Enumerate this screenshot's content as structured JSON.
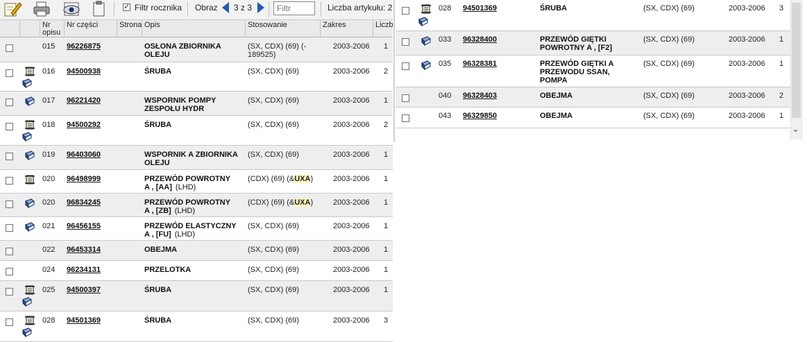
{
  "toolbar": {
    "filter_rocznika_label": "Filtr rocznika",
    "filter_rocznika_checked": true,
    "obraz_label": "Obraz",
    "page_indicator": "3 z 3",
    "filter_placeholder": "Filtr",
    "article_count_label": "Liczba artykułu: 2"
  },
  "columns": {
    "nr_opisu": "Nr opisu",
    "nr_czesci": "Nr części",
    "strona": "Strona",
    "opis": "Opis",
    "stosowanie": "Stosowanie",
    "zakres": "Zakres",
    "liczba": "Liczb"
  },
  "left_rows": [
    {
      "nr": "015",
      "part": "96226875",
      "desc": "OSŁONA ZBIORNIKA OLEJU",
      "desc_lines": [
        "OSŁONA ZBIORNIKA",
        "OLEJU"
      ],
      "side": "",
      "stos_lines": [
        "(SX, CDX) (69) (-",
        "189525)"
      ],
      "zakres": "2003-2006",
      "qty": "1",
      "icons": []
    },
    {
      "nr": "016",
      "part": "94500938",
      "desc_lines": [
        "ŚRUBA"
      ],
      "side": "",
      "stos_lines": [
        "(SX, CDX) (69)"
      ],
      "zakres": "2003-2006",
      "qty": "2",
      "icons": [
        "scroll",
        "book"
      ]
    },
    {
      "nr": "017",
      "part": "96221420",
      "desc_lines": [
        "WSPORNIK POMPY",
        "ZESPOŁU HYDR"
      ],
      "side": "",
      "stos_lines": [
        "(SX, CDX) (69)"
      ],
      "zakres": "2003-2006",
      "qty": "1",
      "icons": [
        "book"
      ]
    },
    {
      "nr": "018",
      "part": "94500292",
      "desc_lines": [
        "ŚRUBA"
      ],
      "side": "",
      "stos_lines": [
        "(SX, CDX) (69)"
      ],
      "zakres": "2003-2006",
      "qty": "2",
      "icons": [
        "scroll",
        "book"
      ]
    },
    {
      "nr": "019",
      "part": "96403060",
      "desc_lines": [
        "WSPORNIK A ZBIORNIKA",
        "OLEJU"
      ],
      "side": "",
      "stos_lines": [
        "(SX, CDX) (69)"
      ],
      "zakres": "2003-2006",
      "qty": "1",
      "icons": [
        "book"
      ]
    },
    {
      "nr": "020",
      "part": "96498999",
      "desc_lines": [
        "PRZEWÓD POWROTNY",
        "A , [AA]"
      ],
      "lhd": "(LHD)",
      "side": "",
      "stos_pre": "(CDX) (69) (&",
      "stos_hl": "UXA",
      "stos_post": ")",
      "zakres": "2003-2006",
      "qty": "1",
      "icons": [
        "scroll"
      ]
    },
    {
      "nr": "020",
      "part": "96834245",
      "desc_lines": [
        "PRZEWÓD POWROTNY",
        "A , [ZB]"
      ],
      "lhd": "(LHD)",
      "side": "",
      "stos_pre": "(CDX) (69) (&",
      "stos_hl": "UXA",
      "stos_post": ")",
      "zakres": "2003-2006",
      "qty": "1",
      "icons": [
        "book"
      ]
    },
    {
      "nr": "021",
      "part": "96456155",
      "desc_lines": [
        "PRZEWÓD ELASTYCZNY",
        "A , [FU]"
      ],
      "lhd": "(LHD)",
      "side": "",
      "stos_lines": [
        "(SX, CDX) (69)"
      ],
      "zakres": "2003-2006",
      "qty": "1",
      "icons": [
        "book"
      ]
    },
    {
      "nr": "022",
      "part": "96453314",
      "desc_lines": [
        "OBEJMA"
      ],
      "side": "",
      "stos_lines": [
        "(SX, CDX) (69)"
      ],
      "zakres": "2003-2006",
      "qty": "1",
      "icons": []
    },
    {
      "nr": "024",
      "part": "96234131",
      "desc_lines": [
        "PRZELOTKA"
      ],
      "side": "",
      "stos_lines": [
        "(SX, CDX) (69)"
      ],
      "zakres": "2003-2006",
      "qty": "1",
      "icons": []
    },
    {
      "nr": "025",
      "part": "94500397",
      "desc_lines": [
        "ŚRUBA"
      ],
      "side": "",
      "stos_lines": [
        "(SX, CDX) (69)"
      ],
      "zakres": "2003-2006",
      "qty": "1",
      "icons": [
        "scroll",
        "book"
      ]
    },
    {
      "nr": "028",
      "part": "94501369",
      "desc_lines": [
        "ŚRUBA"
      ],
      "side": "",
      "stos_lines": [
        "(SX, CDX) (69)"
      ],
      "zakres": "2003-2006",
      "qty": "3",
      "icons": [
        "scroll",
        "book"
      ]
    }
  ],
  "right_rows": [
    {
      "nr": "028",
      "part": "94501369",
      "desc_lines": [
        "ŚRUBA"
      ],
      "stos": "(SX, CDX) (69)",
      "zakres": "2003-2006",
      "qty": "3",
      "icons": [
        "scroll",
        "book"
      ]
    },
    {
      "nr": "033",
      "part": "96328400",
      "desc_lines": [
        "PRZEWÓD GIĘTKI",
        "POWROTNY A , [F2]"
      ],
      "stos": "(SX, CDX) (69)",
      "zakres": "2003-2006",
      "qty": "1",
      "icons": [
        "book"
      ]
    },
    {
      "nr": "035",
      "part": "96328381",
      "desc_lines": [
        "PRZEWÓD GIĘTKI A",
        "PRZEWODU SSAN,",
        "POMPA"
      ],
      "stos": "(SX, CDX) (69)",
      "zakres": "2003-2006",
      "qty": "1",
      "icons": [
        "book"
      ]
    },
    {
      "nr": "040",
      "part": "96328403",
      "desc_lines": [
        "OBEJMA"
      ],
      "stos": "(SX, CDX) (69)",
      "zakres": "2003-2006",
      "qty": "2",
      "icons": []
    },
    {
      "nr": "043",
      "part": "96329850",
      "desc_lines": [
        "OBEJMA"
      ],
      "stos": "(SX, CDX) (69)",
      "zakres": "2003-2006",
      "qty": "1",
      "icons": []
    }
  ]
}
